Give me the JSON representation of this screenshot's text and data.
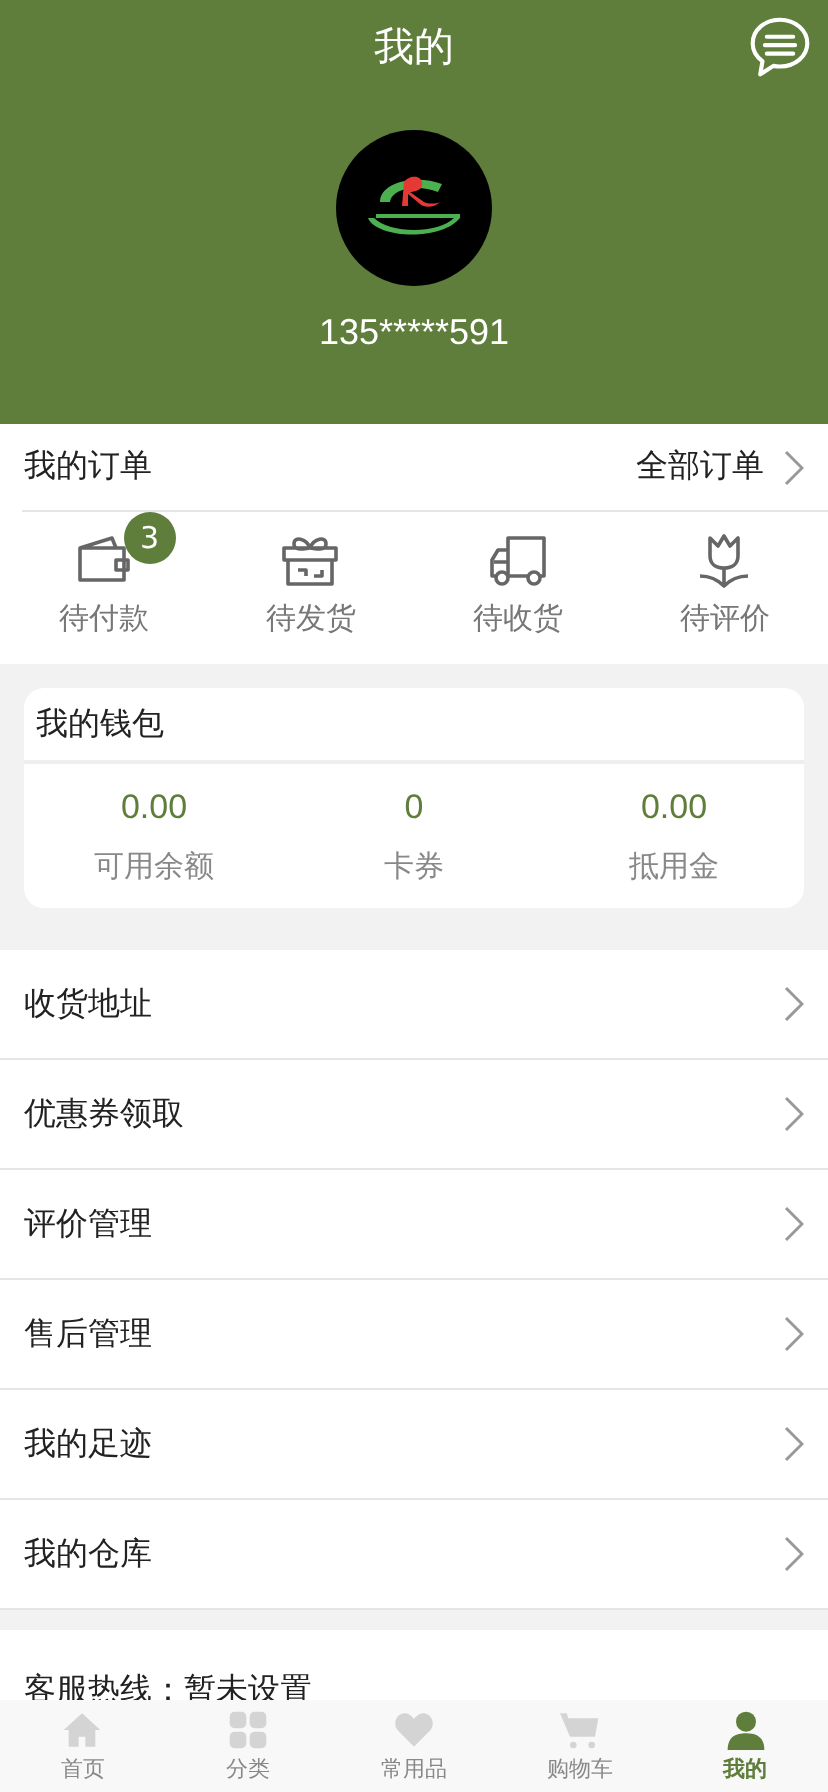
{
  "header": {
    "title": "我的",
    "phone": "135*****591"
  },
  "orders": {
    "title": "我的订单",
    "all_link": "全部订单",
    "statuses": [
      {
        "kind": "wallet",
        "label": "待付款",
        "badge": "3"
      },
      {
        "kind": "gift",
        "label": "待发货"
      },
      {
        "kind": "truck",
        "label": "待收货"
      },
      {
        "kind": "flower",
        "label": "待评价"
      }
    ]
  },
  "wallet": {
    "title": "我的钱包",
    "items": [
      {
        "value": "0.00",
        "label": "可用余额"
      },
      {
        "value": "0",
        "label": "卡券"
      },
      {
        "value": "0.00",
        "label": "抵用金"
      }
    ]
  },
  "menu": [
    "收货地址",
    "优惠券领取",
    "评价管理",
    "售后管理",
    "我的足迹",
    "我的仓库"
  ],
  "hotline": "客服热线：暂未设置",
  "tabs": [
    {
      "kind": "home",
      "label": "首页",
      "selected": false
    },
    {
      "kind": "grid",
      "label": "分类",
      "selected": false
    },
    {
      "kind": "heart",
      "label": "常用品",
      "selected": false
    },
    {
      "kind": "cart",
      "label": "购物车",
      "selected": false
    },
    {
      "kind": "person",
      "label": "我的",
      "selected": true
    }
  ]
}
